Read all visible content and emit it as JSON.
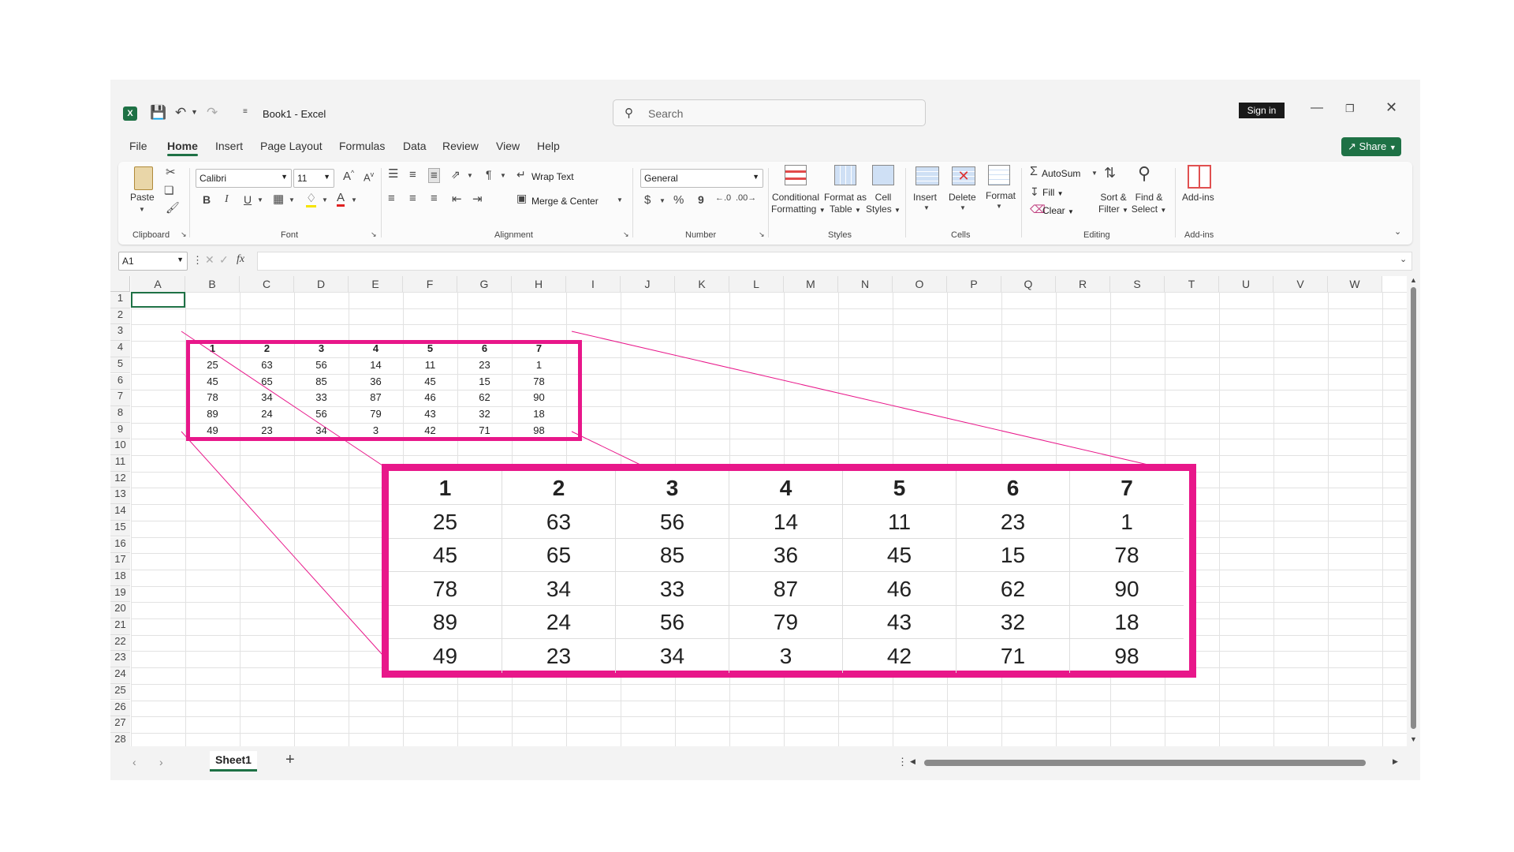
{
  "app": {
    "name": "Excel",
    "book": "Book1",
    "separator": "-"
  },
  "search": {
    "placeholder": "Search"
  },
  "account": {
    "sign_in": "Sign in",
    "share": "Share"
  },
  "tabs": [
    "File",
    "Home",
    "Insert",
    "Page Layout",
    "Formulas",
    "Data",
    "Review",
    "View",
    "Help"
  ],
  "ribbon": {
    "clipboard": {
      "paste": "Paste",
      "group": "Clipboard"
    },
    "font": {
      "name": "Calibri",
      "size": "11",
      "group": "Font"
    },
    "alignment": {
      "wrap": "Wrap Text",
      "merge": "Merge & Center",
      "group": "Alignment"
    },
    "number": {
      "format": "General",
      "currency": "$",
      "percent": "%",
      "comma": "9",
      "group": "Number"
    },
    "styles": {
      "cond_1": "Conditional",
      "cond_2": "Formatting",
      "fmt_1": "Format as",
      "fmt_2": "Table",
      "cell_1": "Cell",
      "cell_2": "Styles",
      "group": "Styles"
    },
    "cells": {
      "insert": "Insert",
      "delete": "Delete",
      "format": "Format",
      "group": "Cells"
    },
    "editing": {
      "autosum": "AutoSum",
      "fill": "Fill",
      "clear": "Clear",
      "sort_1": "Sort &",
      "sort_2": "Filter",
      "find_1": "Find &",
      "find_2": "Select",
      "group": "Editing"
    },
    "addins": {
      "label": "Add-ins",
      "group": "Add-ins"
    }
  },
  "formula_bar": {
    "name_box": "A1",
    "fx": "fx",
    "value": ""
  },
  "columns": [
    "A",
    "B",
    "C",
    "D",
    "E",
    "F",
    "G",
    "H",
    "I",
    "J",
    "K",
    "L",
    "M",
    "N",
    "O",
    "P",
    "Q",
    "R",
    "S",
    "T",
    "U",
    "V",
    "W"
  ],
  "rows": [
    "1",
    "2",
    "3",
    "4",
    "5",
    "6",
    "7",
    "8",
    "9",
    "10",
    "11",
    "12",
    "13",
    "14",
    "15",
    "16",
    "17",
    "18",
    "19",
    "20",
    "21",
    "22",
    "23",
    "24",
    "25",
    "26",
    "27",
    "28"
  ],
  "table": {
    "header": [
      "1",
      "2",
      "3",
      "4",
      "5",
      "6",
      "7"
    ],
    "rows": [
      [
        "25",
        "63",
        "56",
        "14",
        "11",
        "23",
        "1"
      ],
      [
        "45",
        "65",
        "85",
        "36",
        "45",
        "15",
        "78"
      ],
      [
        "78",
        "34",
        "33",
        "87",
        "46",
        "62",
        "90"
      ],
      [
        "89",
        "24",
        "56",
        "79",
        "43",
        "32",
        "18"
      ],
      [
        "49",
        "23",
        "34",
        "3",
        "42",
        "71",
        "98"
      ]
    ]
  },
  "sheet": {
    "name": "Sheet1",
    "add": "+"
  },
  "colors": {
    "accent": "#1e7145",
    "highlight": "#e8178a"
  }
}
